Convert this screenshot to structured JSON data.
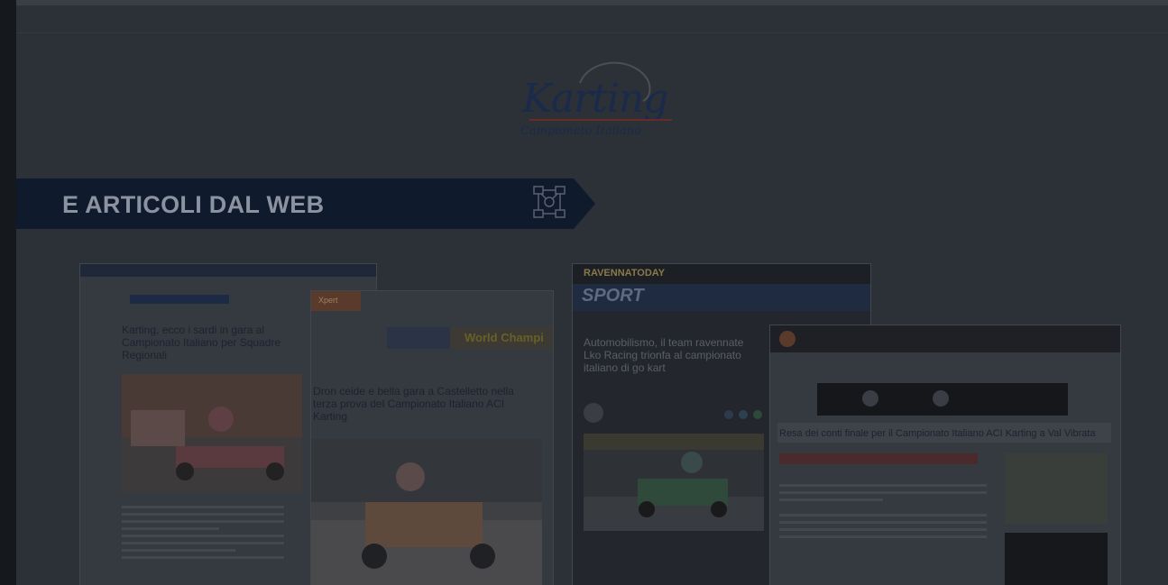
{
  "logo": {
    "title": "Karting",
    "subtitle": "Campionato Italiano"
  },
  "banner": {
    "title": "E ARTICOLI DAL WEB",
    "icon": "network-icon"
  },
  "articles": [
    {
      "title": "Karting, ecco i sardi in gara al Campionato Italiano per Squadre Regionali"
    },
    {
      "brand": "Xpert",
      "ad_text": "World Champi",
      "title": "Dron ceide e bella gara a Castelletto nella terza prova del Campionato Italiano ACI Karting"
    },
    {
      "brand": "RAVENNATODAY",
      "section": "SPORT",
      "title": "Automobilismo, il team ravennate Lko Racing trionfa al campionato italiano di go kart"
    },
    {
      "title": "Resa dei conti finale per il Campionato Italiano ACI Karting a Val Vibrata"
    }
  ],
  "colors": {
    "banner_bg": "#0f1a2d",
    "overlay": "#2c3037"
  }
}
